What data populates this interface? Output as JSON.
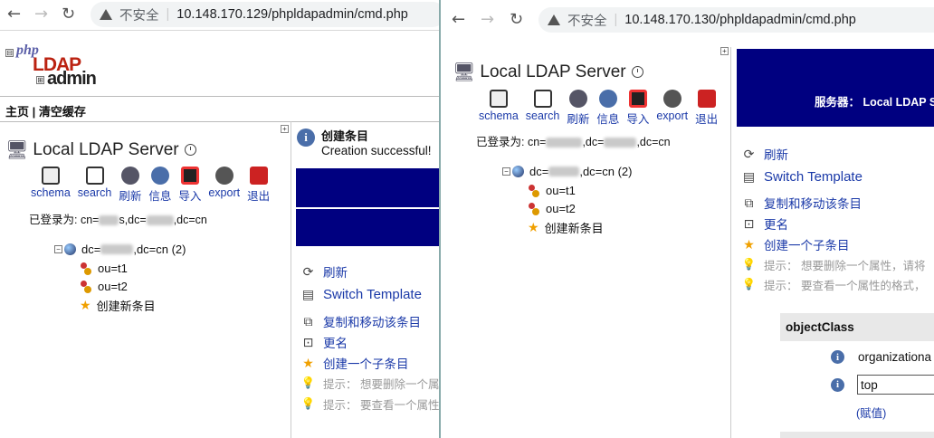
{
  "left": {
    "address": {
      "insecure": "不安全",
      "url": "10.148.170.129/phpldapadmin/cmd.php"
    },
    "logo": {
      "php": "php",
      "ldap": "LDAP",
      "admin": "admin"
    },
    "menu": {
      "home": "主页",
      "divider": "|",
      "clear_cache": "清空缓存"
    },
    "server_title": "Local LDAP Server",
    "toolbar": [
      "schema",
      "search",
      "刷新",
      "信息",
      "导入",
      "export",
      "退出"
    ],
    "logged_in": {
      "prefix": "已登录为: cn=",
      "mid1": "s,dc=",
      "mid2": ",dc=cn"
    },
    "tree": {
      "root_prefix": "dc=",
      "root_suffix": ",dc=cn (2)",
      "children": [
        "ou=t1",
        "ou=t2"
      ],
      "create": "创建新条目"
    },
    "message": {
      "title": "创建条目",
      "text": "Creation successful!"
    },
    "actions": [
      "刷新",
      "Switch Template",
      "复制和移动该条目",
      "更名",
      "创建一个子条目"
    ],
    "hints": [
      "提示： 想要删除一个属",
      "提示： 要查看一个属性"
    ]
  },
  "right": {
    "address": {
      "insecure": "不安全",
      "url": "10.148.170.130/phpldapadmin/cmd.php"
    },
    "server_title": "Local LDAP Server",
    "toolbar": [
      "schema",
      "search",
      "刷新",
      "信息",
      "导入",
      "export",
      "退出"
    ],
    "logged_in": {
      "prefix": "已登录为: cn=",
      "mid1": ",dc=",
      "mid2": ",dc=cn"
    },
    "tree": {
      "root_prefix": "dc=",
      "root_suffix": ",dc=cn (2)",
      "children": [
        "ou=t1",
        "ou=t2"
      ],
      "create": "创建新条目"
    },
    "banner": "服务器： Local LDAP S",
    "actions": [
      "刷新",
      "Switch Template",
      "复制和移动该条目",
      "更名",
      "创建一个子条目"
    ],
    "hints": [
      "提示： 想要删除一个属性，请将",
      "提示： 要查看一个属性的格式，"
    ],
    "attr": {
      "name": "objectClass",
      "values": [
        "organizationa",
        "top"
      ],
      "add_value": "(赋值)"
    }
  }
}
